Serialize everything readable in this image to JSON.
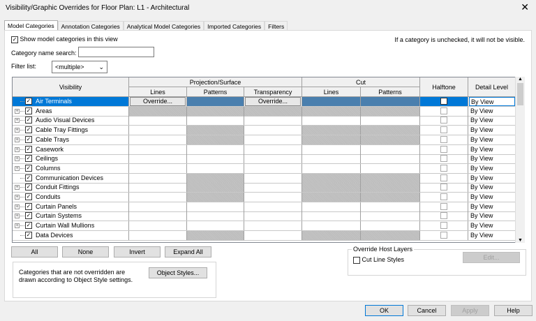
{
  "window": {
    "title": "Visibility/Graphic Overrides for Floor Plan: L1 - Architectural",
    "close": "✕"
  },
  "tabs": [
    "Model Categories",
    "Annotation Categories",
    "Analytical Model Categories",
    "Imported Categories",
    "Filters"
  ],
  "show_model_label": "Show model categories in this view",
  "hint": "If a category is unchecked, it will not be visible.",
  "search_label": "Category name search:",
  "search_value": "",
  "filter_label": "Filter list:",
  "filter_value": "<multiple>",
  "headers": {
    "visibility": "Visibility",
    "projection": "Projection/Surface",
    "lines": "Lines",
    "patterns": "Patterns",
    "transparency": "Transparency",
    "cut": "Cut",
    "cut_lines": "Lines",
    "cut_patterns": "Patterns",
    "halftone": "Halftone",
    "detail_level": "Detail Level"
  },
  "override_label": "Override...",
  "rows": [
    {
      "name": "Air Terminals",
      "expand": false,
      "gray": [],
      "selected": true,
      "detail": "By View"
    },
    {
      "name": "Areas",
      "expand": true,
      "gray": [
        0,
        1,
        2,
        3,
        4
      ],
      "detail": "By View"
    },
    {
      "name": "Audio Visual Devices",
      "expand": true,
      "gray": [],
      "detail": "By View"
    },
    {
      "name": "Cable Tray Fittings",
      "expand": true,
      "gray": [
        1,
        3,
        4
      ],
      "detail": "By View"
    },
    {
      "name": "Cable Trays",
      "expand": true,
      "gray": [
        1,
        3,
        4
      ],
      "detail": "By View"
    },
    {
      "name": "Casework",
      "expand": true,
      "gray": [],
      "detail": "By View"
    },
    {
      "name": "Ceilings",
      "expand": true,
      "gray": [],
      "detail": "By View"
    },
    {
      "name": "Columns",
      "expand": true,
      "gray": [],
      "detail": "By View"
    },
    {
      "name": "Communication Devices",
      "expand": false,
      "gray": [
        1,
        3,
        4
      ],
      "detail": "By View"
    },
    {
      "name": "Conduit Fittings",
      "expand": true,
      "gray": [
        1,
        3,
        4
      ],
      "detail": "By View"
    },
    {
      "name": "Conduits",
      "expand": true,
      "gray": [
        1,
        3,
        4
      ],
      "detail": "By View"
    },
    {
      "name": "Curtain Panels",
      "expand": true,
      "gray": [],
      "detail": "By View"
    },
    {
      "name": "Curtain Systems",
      "expand": true,
      "gray": [],
      "detail": "By View"
    },
    {
      "name": "Curtain Wall Mullions",
      "expand": true,
      "gray": [],
      "detail": "By View"
    },
    {
      "name": "Data Devices",
      "expand": false,
      "gray": [
        1,
        3,
        4
      ],
      "detail": "By View"
    }
  ],
  "buttons": {
    "all": "All",
    "none": "None",
    "invert": "Invert",
    "expand_all": "Expand All",
    "object_styles": "Object Styles...",
    "edit": "Edit...",
    "ok": "OK",
    "cancel": "Cancel",
    "apply": "Apply",
    "help": "Help"
  },
  "note": "Categories that are not overridden are drawn according to Object Style settings.",
  "host_layers": {
    "title": "Override Host Layers",
    "cut_line_styles": "Cut Line Styles"
  }
}
